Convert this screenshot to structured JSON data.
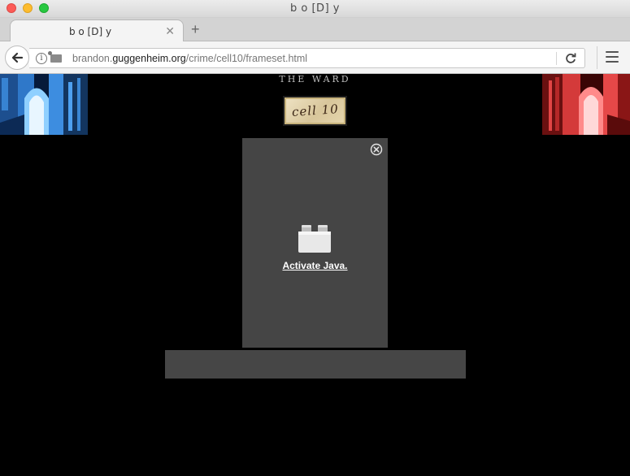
{
  "window": {
    "title": "b o [D] y"
  },
  "tabs": [
    {
      "title": "b o [D] y"
    }
  ],
  "toolbar": {
    "url_prefix": "brandon.",
    "url_domain": "guggenheim.org",
    "url_path": "/crime/cell10/frameset.html"
  },
  "page": {
    "header_title": "THE WARD",
    "cell_label": "cell 10",
    "plugin": {
      "activate_label": "Activate Java."
    }
  },
  "colors": {
    "page_background": "#000000",
    "plugin_background": "#454545",
    "left_corridor_tint": "#3f9bff",
    "right_corridor_tint": "#ff4b4b"
  }
}
